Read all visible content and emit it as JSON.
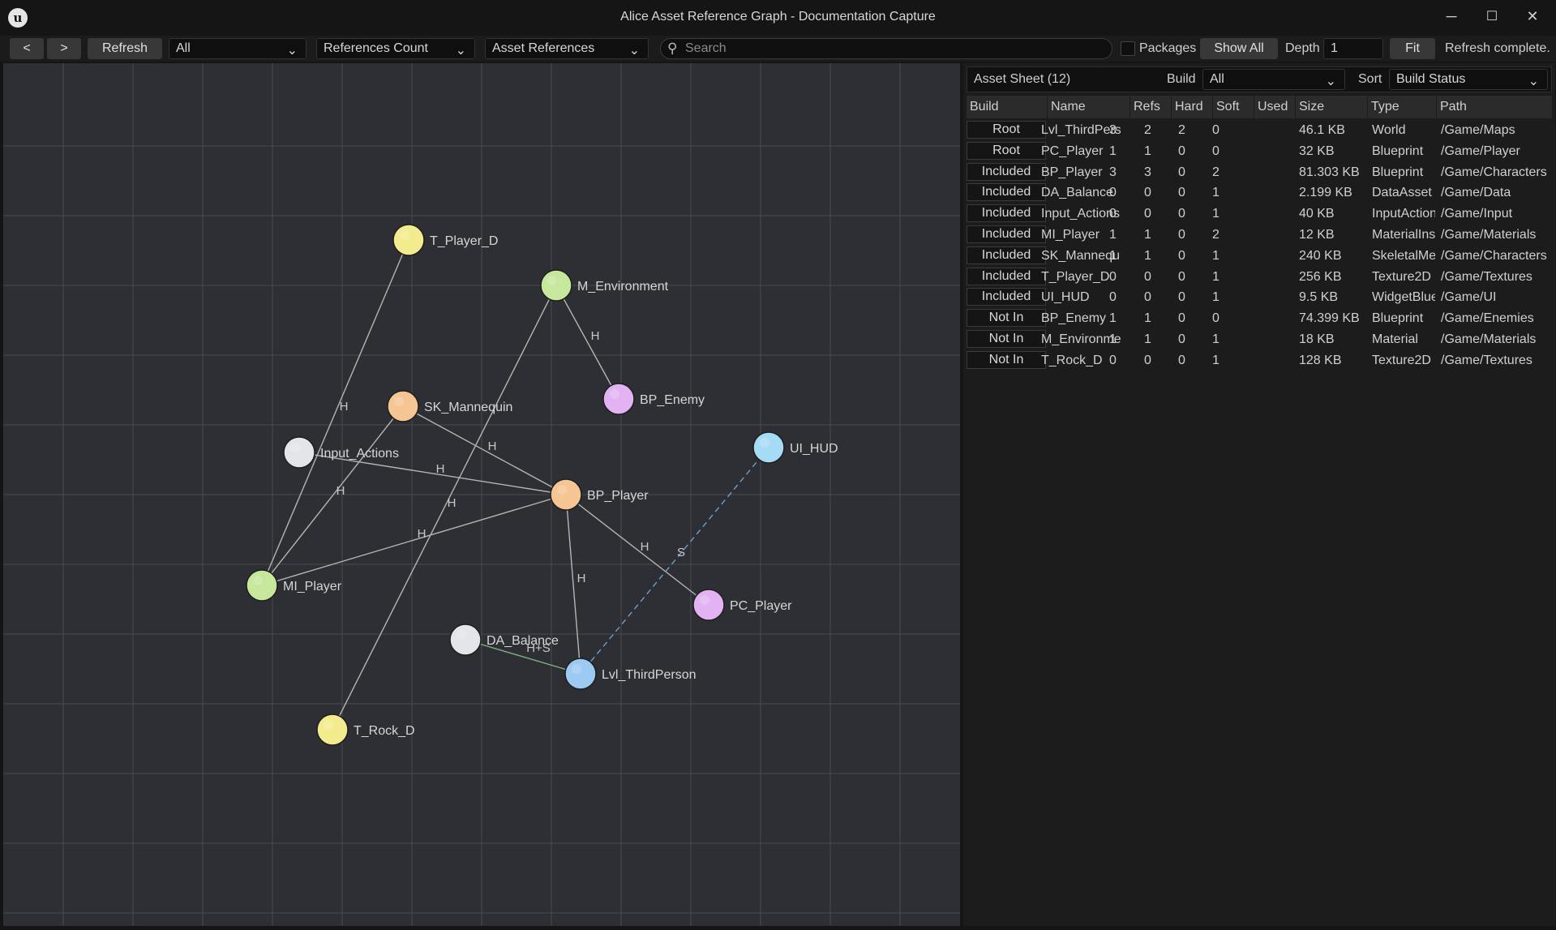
{
  "window": {
    "title": "Alice Asset Reference Graph - Documentation Capture",
    "minimize_icon": "minimize-icon",
    "maximize_icon": "maximize-icon",
    "close_icon": "close-icon",
    "logo_glyph": "u",
    "min_glyph": "─",
    "max_glyph": "☐",
    "close_glyph": "✕"
  },
  "toolbar": {
    "back_label": "<",
    "forward_label": ">",
    "refresh_label": "Refresh",
    "filter_value": "All",
    "metric_value": "References Count",
    "mode_value": "Asset References",
    "search_placeholder": "Search",
    "packages_label": "Packages",
    "show_all_label": "Show All",
    "depth_label": "Depth",
    "depth_value": "1",
    "fit_label": "Fit",
    "status_text": "Refresh complete.",
    "chevron": "⌄",
    "search_glyph": "⚲"
  },
  "graph": {
    "nodes": [
      {
        "id": "T_Player_D",
        "label": "T_Player_D",
        "color": "#f3ec8e"
      },
      {
        "id": "M_Environment",
        "label": "M_Environment",
        "color": "#c6e79c"
      },
      {
        "id": "BP_Enemy",
        "label": "BP_Enemy",
        "color": "#e2b2f2"
      },
      {
        "id": "SK_Mannequin",
        "label": "SK_Mannequin",
        "color": "#f5c594"
      },
      {
        "id": "UI_HUD",
        "label": "UI_HUD",
        "color": "#a6dbf5"
      },
      {
        "id": "Input_Actions",
        "label": "Input_Actions",
        "color": "#e3e5ea"
      },
      {
        "id": "BP_Player",
        "label": "BP_Player",
        "color": "#f5c594"
      },
      {
        "id": "MI_Player",
        "label": "MI_Player",
        "color": "#c6e79c"
      },
      {
        "id": "PC_Player",
        "label": "PC_Player",
        "color": "#e2b2f2"
      },
      {
        "id": "DA_Balance",
        "label": "DA_Balance",
        "color": "#e3e5ea"
      },
      {
        "id": "Lvl_ThirdPerson",
        "label": "Lvl_ThirdPerson",
        "color": "#9ccaf2"
      },
      {
        "id": "T_Rock_D",
        "label": "T_Rock_D",
        "color": "#f3ec8e"
      }
    ],
    "edges": [
      {
        "from": "MI_Player",
        "to": "T_Player_D",
        "label": "H",
        "type": "hard"
      },
      {
        "from": "M_Environment",
        "to": "BP_Enemy",
        "label": "H",
        "type": "hard"
      },
      {
        "from": "M_Environment",
        "to": "T_Rock_D",
        "label": "H",
        "type": "hard"
      },
      {
        "from": "SK_Mannequin",
        "to": "BP_Player",
        "label": "H",
        "type": "hard"
      },
      {
        "from": "SK_Mannequin",
        "to": "MI_Player",
        "label": "H",
        "type": "hard"
      },
      {
        "from": "Input_Actions",
        "to": "BP_Player",
        "label": "H",
        "type": "hard"
      },
      {
        "from": "MI_Player",
        "to": "BP_Player",
        "label": "H",
        "type": "hard"
      },
      {
        "from": "BP_Player",
        "to": "PC_Player",
        "label": "H",
        "type": "hard"
      },
      {
        "from": "BP_Player",
        "to": "Lvl_ThirdPerson",
        "label": "H",
        "type": "hard"
      },
      {
        "from": "UI_HUD",
        "to": "Lvl_ThirdPerson",
        "label": "S",
        "type": "soft"
      },
      {
        "from": "DA_Balance",
        "to": "Lvl_ThirdPerson",
        "label": "H+S",
        "type": "both"
      }
    ],
    "colors": {
      "background": "#2e2f34",
      "grid": "#4a4b50",
      "edge": "#b5b5b5",
      "soft_edge": "#6f9fc8",
      "both_edge": "#7fae86"
    }
  },
  "sheet": {
    "title": "Asset Sheet (12)",
    "build_label": "Build",
    "build_value": "All",
    "sort_label": "Sort",
    "sort_value": "Build Status",
    "columns": [
      "Build",
      "Name",
      "Refs",
      "Hard",
      "Soft",
      "Used",
      "Size",
      "Type",
      "Path"
    ],
    "rows": [
      {
        "build": "Root",
        "name": "Lvl_ThirdPerson",
        "refs": "3",
        "hard": "2",
        "soft": "2",
        "used": "0",
        "size": "46.1 KB",
        "type": "World",
        "path": "/Game/Maps"
      },
      {
        "build": "Root",
        "name": "PC_Player",
        "refs": "1",
        "hard": "1",
        "soft": "0",
        "used": "0",
        "size": "32 KB",
        "type": "Blueprint",
        "path": "/Game/Player"
      },
      {
        "build": "Included",
        "name": "BP_Player",
        "refs": "3",
        "hard": "3",
        "soft": "0",
        "used": "2",
        "size": "81.303 KB",
        "type": "Blueprint",
        "path": "/Game/Characters"
      },
      {
        "build": "Included",
        "name": "DA_Balance",
        "refs": "0",
        "hard": "0",
        "soft": "0",
        "used": "1",
        "size": "2.199 KB",
        "type": "DataAsset",
        "path": "/Game/Data"
      },
      {
        "build": "Included",
        "name": "Input_Actions",
        "refs": "0",
        "hard": "0",
        "soft": "0",
        "used": "1",
        "size": "40 KB",
        "type": "InputAction",
        "path": "/Game/Input"
      },
      {
        "build": "Included",
        "name": "MI_Player",
        "refs": "1",
        "hard": "1",
        "soft": "0",
        "used": "2",
        "size": "12 KB",
        "type": "MaterialInstance",
        "path": "/Game/Materials"
      },
      {
        "build": "Included",
        "name": "SK_Mannequin",
        "refs": "1",
        "hard": "1",
        "soft": "0",
        "used": "1",
        "size": "240 KB",
        "type": "SkeletalMesh",
        "path": "/Game/Characters"
      },
      {
        "build": "Included",
        "name": "T_Player_D",
        "refs": "0",
        "hard": "0",
        "soft": "0",
        "used": "1",
        "size": "256 KB",
        "type": "Texture2D",
        "path": "/Game/Textures"
      },
      {
        "build": "Included",
        "name": "UI_HUD",
        "refs": "0",
        "hard": "0",
        "soft": "0",
        "used": "1",
        "size": "9.5 KB",
        "type": "WidgetBlueprint",
        "path": "/Game/UI"
      },
      {
        "build": "Not In",
        "name": "BP_Enemy",
        "refs": "1",
        "hard": "1",
        "soft": "0",
        "used": "0",
        "size": "74.399 KB",
        "type": "Blueprint",
        "path": "/Game/Enemies"
      },
      {
        "build": "Not In",
        "name": "M_Environment",
        "refs": "1",
        "hard": "1",
        "soft": "0",
        "used": "1",
        "size": "18 KB",
        "type": "Material",
        "path": "/Game/Materials"
      },
      {
        "build": "Not In",
        "name": "T_Rock_D",
        "refs": "0",
        "hard": "0",
        "soft": "0",
        "used": "1",
        "size": "128 KB",
        "type": "Texture2D",
        "path": "/Game/Textures"
      }
    ]
  }
}
